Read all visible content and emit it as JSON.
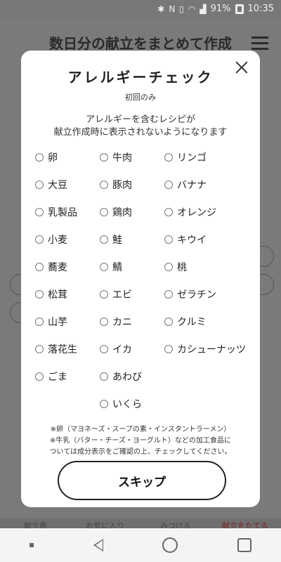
{
  "status_bar": {
    "battery_percent": "91%",
    "time": "10:35"
  },
  "background": {
    "page_title": "数日分の献立をまとめて作成",
    "bottom_nav": [
      "献立表",
      "お気に入り",
      "みつける",
      "献立をたてる"
    ]
  },
  "modal": {
    "title": "アレルギーチェック",
    "subtitle": "初回のみ",
    "description": [
      "アレルギーを含むレシピが",
      "献立作成時に表示されないようになります"
    ],
    "allergens": {
      "col1": [
        "卵",
        "大豆",
        "乳製品",
        "小麦",
        "蕎麦",
        "松茸",
        "山芋",
        "落花生",
        "ごま"
      ],
      "col2": [
        "牛肉",
        "豚肉",
        "鶏肉",
        "鮭",
        "鯖",
        "エビ",
        "カニ",
        "イカ",
        "あわび",
        "いくら"
      ],
      "col3": [
        "リンゴ",
        "バナナ",
        "オレンジ",
        "キウイ",
        "桃",
        "ゼラチン",
        "クルミ",
        "カシューナッツ"
      ]
    },
    "notes": [
      "※卵（マヨネーズ・スープの素・インスタントラーメン）",
      "※牛乳（バター・チーズ・ヨーグルト）などの加工食品に",
      "ついては成分表示をご確認の上、チェックしてください。"
    ],
    "skip_label": "スキップ"
  }
}
